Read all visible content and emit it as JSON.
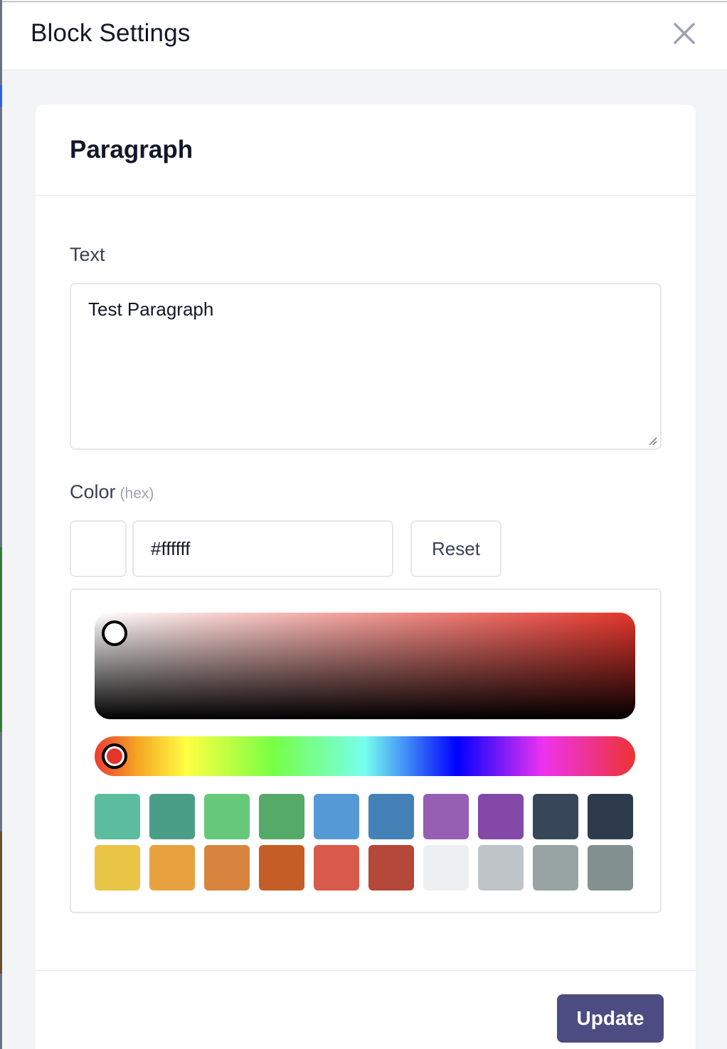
{
  "header": {
    "title": "Block Settings",
    "close_icon": "close-icon"
  },
  "card": {
    "title": "Paragraph"
  },
  "text_field": {
    "label": "Text",
    "value": "Test Paragraph"
  },
  "color_field": {
    "label": "Color",
    "hint": "(hex)",
    "value": "#ffffff",
    "reset_label": "Reset",
    "preview_color": "#ffffff",
    "hue_color": "#e5352b"
  },
  "palette": [
    "#5bbd9e",
    "#4a9e87",
    "#66c97a",
    "#55aa6a",
    "#5599d7",
    "#4381b7",
    "#965fb3",
    "#8448a6",
    "#374659",
    "#2e3b4d",
    "#e8c547",
    "#e8a13f",
    "#d8843e",
    "#c55e26",
    "#d85a4a",
    "#b54839",
    "#edf0f1",
    "#bec4c7",
    "#98a4a4",
    "#839190"
  ],
  "footer": {
    "update_label": "Update"
  }
}
